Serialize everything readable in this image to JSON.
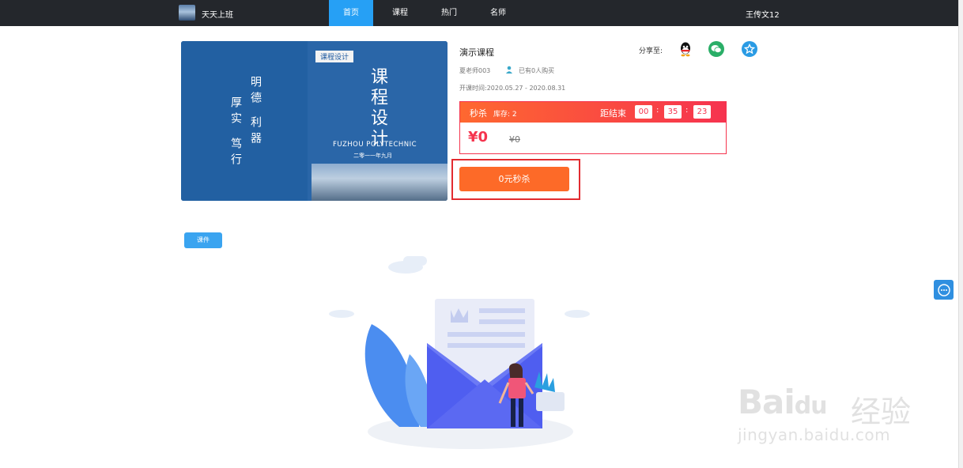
{
  "header": {
    "site_name": "天天上班",
    "nav": [
      {
        "label": "首页",
        "active": true
      },
      {
        "label": "课程",
        "active": false
      },
      {
        "label": "热门",
        "active": false
      },
      {
        "label": "名师",
        "active": false
      }
    ],
    "user": "王传文12"
  },
  "course": {
    "cover": {
      "tag": "课程设计",
      "title": "课程设计",
      "left_col1": "明德",
      "left_col2": "利器",
      "left_col3": "厚实",
      "left_col4": "笃行",
      "school_en": "FUZHOU POLYTECHNIC",
      "date_cn": "二零一一年九月"
    },
    "title": "演示课程",
    "teacher": "夏老师003",
    "buyers": "已有0人购买",
    "dates": "开课时间:2020.05.27 - 2020.08.31",
    "share_label": "分享至:",
    "share_icons": [
      "qq-icon",
      "wechat-icon",
      "qzone-icon"
    ]
  },
  "sale": {
    "label": "秒杀",
    "stock": "库存: 2",
    "countdown_label": "距结束",
    "hours": "00",
    "minutes": "35",
    "seconds": "23",
    "price_now": "¥0",
    "price_old": "¥0"
  },
  "buy_button": "0元秒杀",
  "tab": "课件",
  "watermark": {
    "brand": "Bai",
    "brand2": "du",
    "cn": "经验",
    "url": "jingyan.baidu.com"
  },
  "colors": {
    "nav_bg": "#24272c",
    "nav_active": "#26a0f5",
    "sale_red": "#f5344e",
    "buy_orange": "#fd6a28",
    "tab_blue": "#3aa4f0"
  }
}
